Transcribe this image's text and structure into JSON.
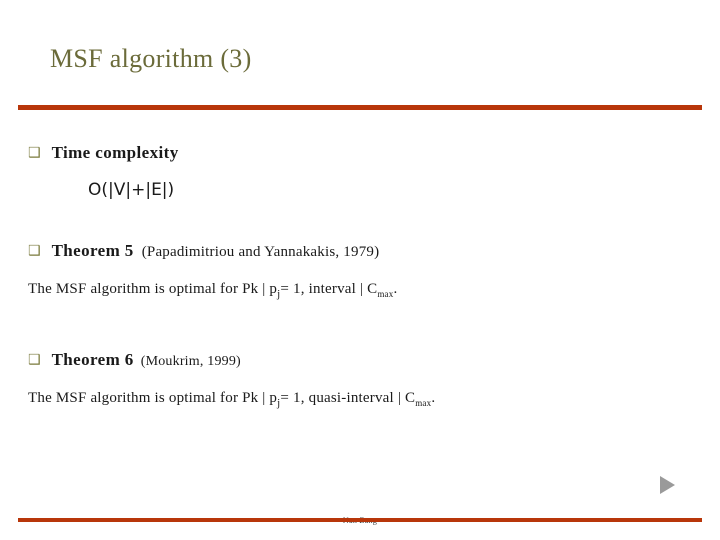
{
  "slide": {
    "title": "MSF algorithm (3)",
    "footer": "Nan Zang",
    "accent_color": "#b8360a",
    "title_color": "#6b6b3a",
    "bullet_glyph": "❑",
    "bullets": [
      {
        "heading": "Time complexity",
        "note": ""
      },
      {
        "heading": "Theorem 5",
        "note": "(Papadimitriou and Yannakakis, 1979)"
      },
      {
        "heading": "Theorem 6",
        "note": "(Moukrim, 1999)"
      }
    ],
    "complexity": "O(|V|+|E|)",
    "theorem5_text_parts": {
      "lead": "The MSF algorithm is optimal for Pk | p",
      "sub1": "j",
      "mid": "= 1, interval | C",
      "sub2": "max",
      "tail": "."
    },
    "theorem6_text_parts": {
      "lead": "The MSF algorithm is optimal for Pk | p",
      "sub1": "j",
      "mid": "= 1, quasi-interval | C",
      "sub2": "max",
      "tail": "."
    },
    "nav_arrow_name": "next-slide-arrow"
  }
}
